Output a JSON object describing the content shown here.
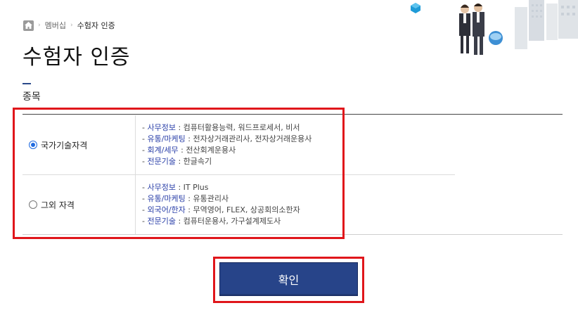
{
  "breadcrumb": {
    "items": [
      "멤버십",
      "수험자 인증"
    ]
  },
  "page": {
    "title": "수험자 인증",
    "section_label": "종목"
  },
  "options": [
    {
      "label": "국가기술자격",
      "checked": true,
      "lines": [
        {
          "category": "사무정보",
          "items": "컴퓨터활용능력, 워드프로세서, 비서"
        },
        {
          "category": "유통/마케팅",
          "items": "전자상거래관리사, 전자상거래운용사"
        },
        {
          "category": "회계/세무",
          "items": "전산회계운용사"
        },
        {
          "category": "전문기술",
          "items": "한글속기"
        }
      ]
    },
    {
      "label": "그외 자격",
      "checked": false,
      "lines": [
        {
          "category": "사무정보",
          "items": "IT Plus"
        },
        {
          "category": "유통/마케팅",
          "items": "유통관리사"
        },
        {
          "category": "외국어/한자",
          "items": "무역영어, FLEX, 상공회의소한자"
        },
        {
          "category": "전문기술",
          "items": "컴퓨터운용사, 가구설계제도사"
        }
      ]
    }
  ],
  "actions": {
    "confirm_label": "확인"
  },
  "colors": {
    "accent": "#274489",
    "category_text": "#2a3fa8",
    "highlight": "#e0161b"
  },
  "icons": {
    "home": "home-icon",
    "hero": "business-people-illustration"
  }
}
